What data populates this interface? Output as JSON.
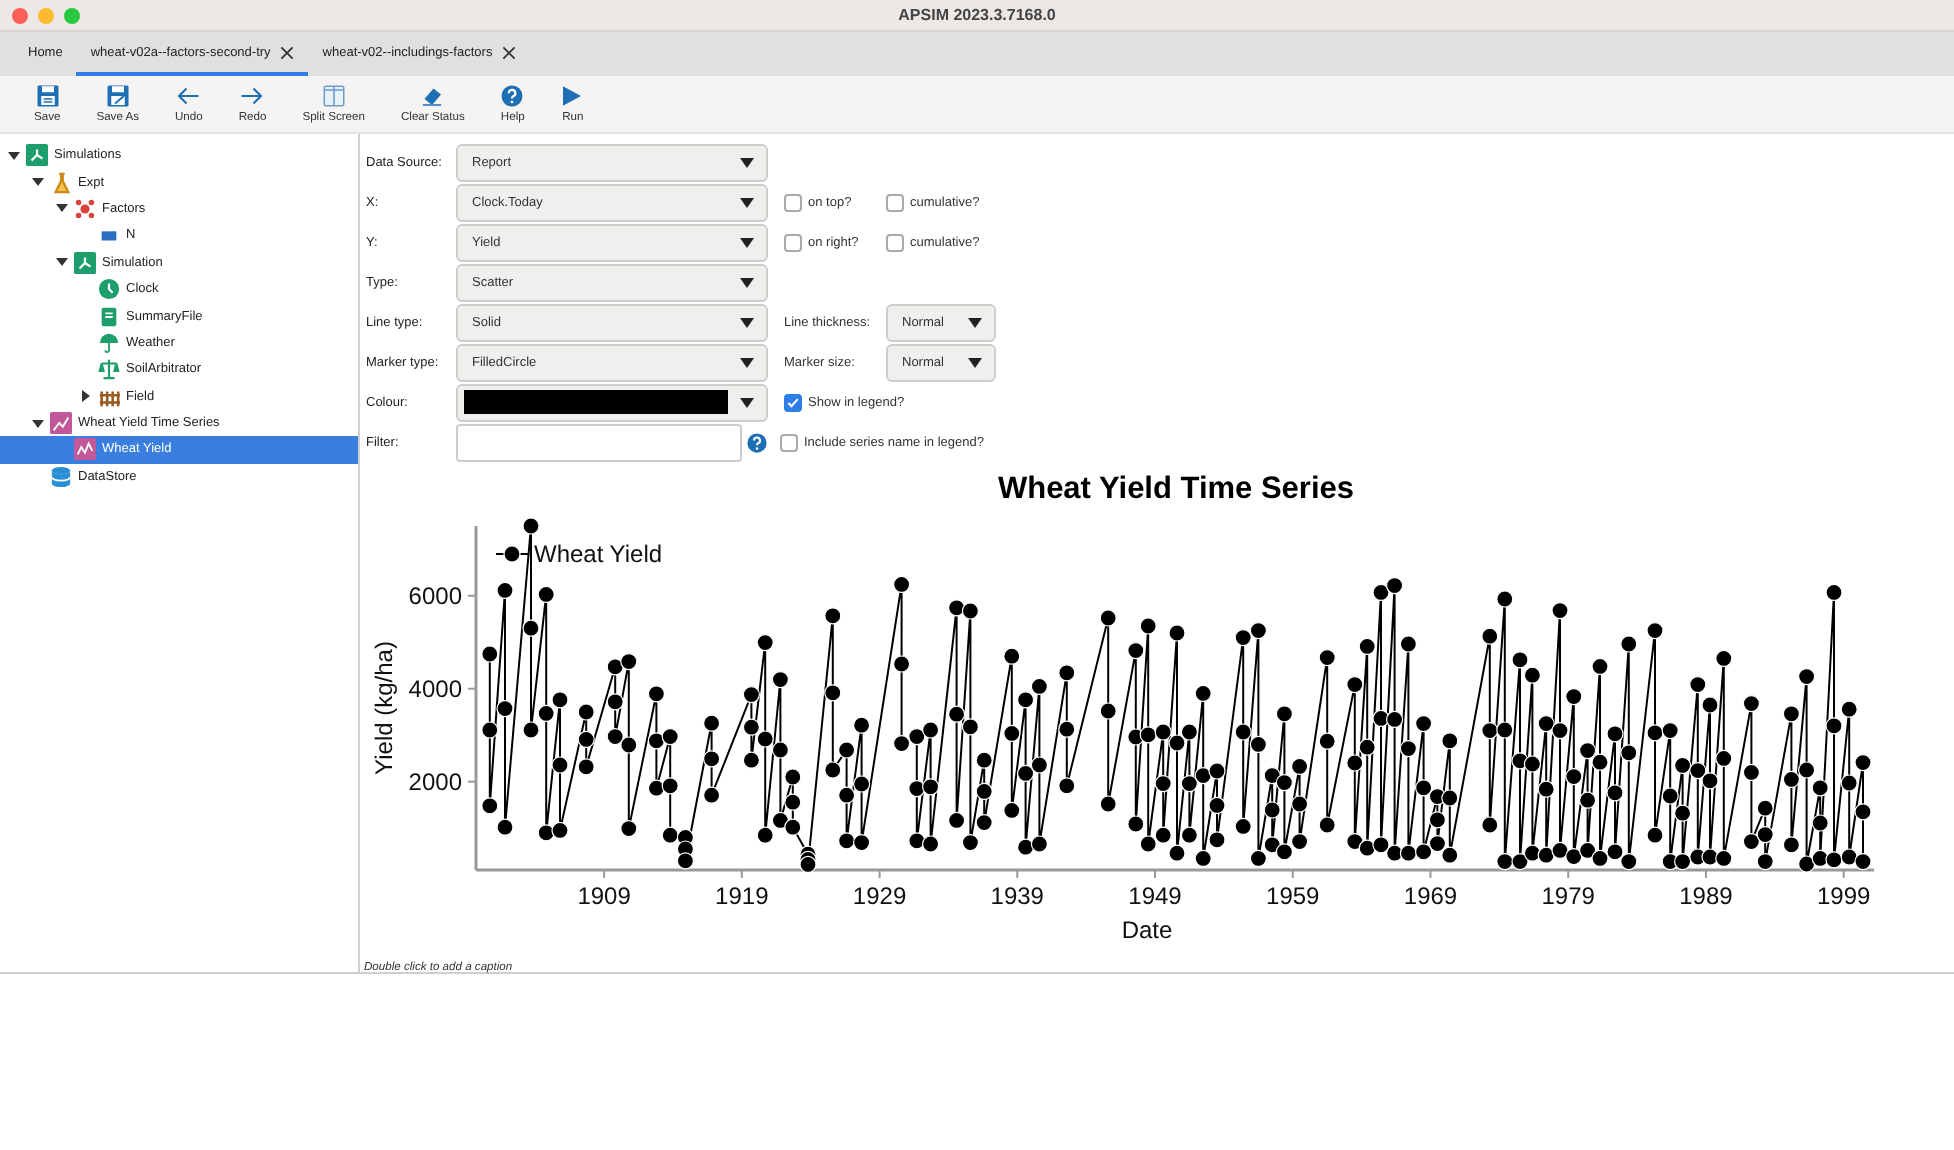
{
  "window": {
    "title": "APSIM 2023.3.7168.0"
  },
  "tabs": [
    {
      "label": "Home",
      "selected": false,
      "closable": false
    },
    {
      "label": "wheat-v02a--factors-second-try",
      "selected": true,
      "closable": true
    },
    {
      "label": "wheat-v02--includings-factors",
      "selected": false,
      "closable": true
    }
  ],
  "toolbar": [
    {
      "kind": "save",
      "label": "Save"
    },
    {
      "kind": "saveas",
      "label": "Save As"
    },
    {
      "kind": "undo",
      "label": "Undo"
    },
    {
      "kind": "redo",
      "label": "Redo"
    },
    {
      "kind": "split",
      "label": "Split Screen"
    },
    {
      "kind": "clear",
      "label": "Clear Status"
    },
    {
      "kind": "help",
      "label": "Help"
    },
    {
      "kind": "run",
      "label": "Run"
    }
  ],
  "tree": [
    {
      "kind": "simulations",
      "label": "Simulations",
      "selected": false,
      "expanded": true,
      "children": [
        {
          "kind": "experiment",
          "label": "Expt",
          "selected": false,
          "expanded": true,
          "children": [
            {
              "kind": "factors",
              "label": "Factors",
              "selected": false,
              "expanded": true,
              "children": [
                {
                  "kind": "factor",
                  "label": "N",
                  "selected": false
                }
              ]
            },
            {
              "kind": "simulation",
              "label": "Simulation",
              "selected": false,
              "expanded": true,
              "children": [
                {
                  "kind": "clock",
                  "label": "Clock",
                  "selected": false
                },
                {
                  "kind": "summary",
                  "label": "SummaryFile",
                  "selected": false
                },
                {
                  "kind": "weather",
                  "label": "Weather",
                  "selected": false
                },
                {
                  "kind": "soil",
                  "label": "SoilArbitrator",
                  "selected": false
                },
                {
                  "kind": "field",
                  "label": "Field",
                  "selected": false,
                  "expanded": false
                }
              ]
            }
          ]
        },
        {
          "kind": "graph",
          "label": "Wheat Yield Time Series",
          "selected": false,
          "expanded": true,
          "children": [
            {
              "kind": "series",
              "label": "Wheat Yield",
              "selected": true
            }
          ]
        },
        {
          "kind": "datastore",
          "label": "DataStore",
          "selected": false
        }
      ]
    }
  ],
  "series_form": [
    {
      "label": "Data Source:",
      "kind": "dropdown",
      "value": "Report"
    },
    {
      "label": "X:",
      "kind": "dropdown",
      "value": "Clock.Today",
      "extras": [
        {
          "kind": "checkbox",
          "label": "on top?",
          "checked": false
        },
        {
          "kind": "checkbox",
          "label": "cumulative?",
          "checked": false
        }
      ]
    },
    {
      "label": "Y:",
      "kind": "dropdown",
      "value": "Yield",
      "extras": [
        {
          "kind": "checkbox",
          "label": "on right?",
          "checked": false
        },
        {
          "kind": "checkbox",
          "label": "cumulative?",
          "checked": false
        }
      ]
    },
    {
      "label": "Type:",
      "kind": "dropdown",
      "value": "Scatter"
    },
    {
      "label": "Line type:",
      "kind": "dropdown",
      "value": "Solid",
      "extras": [
        {
          "kind": "select",
          "label": "Line thickness:",
          "value": "Normal"
        }
      ]
    },
    {
      "label": "Marker type:",
      "kind": "dropdown",
      "value": "FilledCircle",
      "extras": [
        {
          "kind": "select",
          "label": "Marker size:",
          "value": "Normal"
        }
      ]
    },
    {
      "label": "Colour:",
      "kind": "colour",
      "color": "#000000",
      "extras": [
        {
          "kind": "checkbox",
          "label": "Show in legend?",
          "checked": true
        }
      ]
    },
    {
      "label": "Filter:",
      "kind": "text",
      "extras": [
        {
          "kind": "checkbox",
          "label": "Include series name in legend?",
          "checked": false
        }
      ]
    }
  ],
  "graph": {
    "caption": "Double click to add a caption",
    "chart_data": {
      "type": "line",
      "title": "Wheat Yield Time Series",
      "xlabel": "Date",
      "ylabel": "Yield (kg/ha)",
      "xlim": [
        1899.7,
        2001.2
      ],
      "ylim": [
        100,
        7500
      ],
      "xticks": [
        1909,
        1919,
        1929,
        1939,
        1949,
        1959,
        1969,
        1979,
        1989,
        1999
      ],
      "yticks": [
        2000,
        4000,
        6000
      ],
      "x": [
        1900.7,
        1900.7,
        1900.7,
        1901.8,
        1901.8,
        1901.8,
        1903.7,
        1903.7,
        1903.7,
        1904.8,
        1904.8,
        1904.8,
        1905.8,
        1905.8,
        1905.8,
        1907.7,
        1907.7,
        1907.7,
        1909.8,
        1909.8,
        1909.8,
        1910.8,
        1910.8,
        1910.8,
        1912.8,
        1912.8,
        1912.8,
        1913.8,
        1913.8,
        1913.8,
        1914.9,
        1914.9,
        1914.9,
        1916.8,
        1916.8,
        1916.8,
        1919.7,
        1919.7,
        1919.7,
        1920.7,
        1920.7,
        1920.7,
        1921.8,
        1921.8,
        1921.8,
        1922.7,
        1922.7,
        1922.7,
        1923.8,
        1923.8,
        1923.8,
        1925.6,
        1925.6,
        1925.6,
        1926.6,
        1926.6,
        1926.6,
        1927.7,
        1927.7,
        1927.7,
        1930.6,
        1930.6,
        1930.6,
        1931.7,
        1931.7,
        1931.7,
        1932.7,
        1932.7,
        1932.7,
        1934.6,
        1934.6,
        1934.6,
        1935.6,
        1935.6,
        1935.6,
        1936.6,
        1936.6,
        1936.6,
        1938.6,
        1938.6,
        1938.6,
        1939.6,
        1939.6,
        1939.6,
        1940.6,
        1940.6,
        1940.6,
        1942.6,
        1942.6,
        1942.6,
        1945.6,
        1945.6,
        1945.6,
        1947.6,
        1947.6,
        1947.6,
        1948.5,
        1948.5,
        1948.5,
        1949.6,
        1949.6,
        1949.6,
        1950.6,
        1950.6,
        1950.6,
        1951.5,
        1951.5,
        1951.5,
        1952.5,
        1952.5,
        1952.5,
        1953.5,
        1953.5,
        1953.5,
        1955.4,
        1955.4,
        1955.4,
        1956.5,
        1956.5,
        1956.5,
        1957.5,
        1957.5,
        1957.5,
        1958.4,
        1958.4,
        1958.4,
        1959.5,
        1959.5,
        1959.5,
        1961.5,
        1961.5,
        1961.5,
        1963.5,
        1963.5,
        1963.5,
        1964.4,
        1964.4,
        1964.4,
        1965.4,
        1965.4,
        1965.4,
        1966.4,
        1966.4,
        1966.4,
        1967.4,
        1967.4,
        1967.4,
        1968.5,
        1968.5,
        1968.5,
        1969.5,
        1969.5,
        1969.5,
        1970.4,
        1970.4,
        1970.4,
        1973.3,
        1973.3,
        1973.3,
        1974.4,
        1974.4,
        1974.4,
        1975.5,
        1975.5,
        1975.5,
        1976.4,
        1976.4,
        1976.4,
        1977.4,
        1977.4,
        1977.4,
        1978.4,
        1978.4,
        1978.4,
        1979.4,
        1979.4,
        1979.4,
        1980.4,
        1980.4,
        1980.4,
        1981.3,
        1981.3,
        1981.3,
        1982.4,
        1982.4,
        1982.4,
        1983.4,
        1983.4,
        1983.4,
        1985.3,
        1985.3,
        1985.3,
        1986.4,
        1986.4,
        1986.4,
        1987.3,
        1987.3,
        1987.3,
        1988.4,
        1988.4,
        1988.4,
        1989.3,
        1989.3,
        1989.3,
        1990.3,
        1990.3,
        1990.3,
        1992.3,
        1992.3,
        1992.3,
        1993.3,
        1993.3,
        1993.3,
        1995.2,
        1995.2,
        1995.2,
        1996.3,
        1996.3,
        1996.3,
        1997.3,
        1997.3,
        1997.3,
        1998.3,
        1998.3,
        1998.3,
        1999.4,
        1999.4,
        1999.4,
        2000.4,
        2000.4,
        2000.4
      ],
      "series": [
        {
          "name": "Wheat Yield",
          "color": "#000000",
          "marker": "circle",
          "values": [
            4745,
            3110,
            1480,
            6115,
            3570,
            1020,
            7500,
            5300,
            3110,
            6030,
            3470,
            900,
            3760,
            2360,
            950,
            3500,
            2910,
            2320,
            4470,
            3720,
            2970,
            4585,
            2790,
            990,
            3890,
            2880,
            1860,
            2970,
            1910,
            850,
            800,
            550,
            300,
            3260,
            2490,
            1710,
            3875,
            3170,
            2460,
            4990,
            2920,
            850,
            4195,
            2680,
            1165,
            2100,
            1560,
            1020,
            440,
            330,
            220,
            5570,
            3910,
            2250,
            2680,
            1710,
            730,
            3215,
            1950,
            690,
            6245,
            4530,
            2820,
            2970,
            1850,
            730,
            3110,
            1890,
            660,
            5740,
            3450,
            1165,
            5670,
            3180,
            690,
            2460,
            1790,
            1120,
            4700,
            3040,
            1380,
            3760,
            2180,
            590,
            4050,
            2360,
            660,
            4340,
            3130,
            1910,
            5520,
            3520,
            1520,
            4820,
            2960,
            1090,
            5350,
            3010,
            660,
            3070,
            1960,
            850,
            5200,
            2830,
            460,
            3070,
            1960,
            850,
            3900,
            2130,
            350,
            2230,
            1490,
            750,
            5100,
            3070,
            1040,
            5250,
            2800,
            350,
            2130,
            1390,
            640,
            3460,
            1980,
            490,
            2330,
            1520,
            710,
            4670,
            2870,
            1070,
            4090,
            2400,
            710,
            4910,
            2740,
            570,
            6070,
            3360,
            640,
            6220,
            3340,
            460,
            4960,
            2710,
            460,
            3250,
            1870,
            490,
            1680,
            1180,
            670,
            2880,
            1650,
            420,
            5130,
            3100,
            1070,
            5930,
            3110,
            280,
            4620,
            2450,
            280,
            4290,
            2380,
            460,
            3250,
            1840,
            420,
            5680,
            3100,
            520,
            3830,
            2110,
            390,
            2670,
            1600,
            520,
            4480,
            2420,
            350,
            3030,
            1760,
            490,
            4960,
            2620,
            280,
            5250,
            3050,
            850,
            3100,
            1690,
            280,
            2350,
            1320,
            280,
            4090,
            2240,
            380,
            3650,
            2020,
            380,
            4650,
            2500,
            350,
            3680,
            2200,
            710,
            1430,
            860,
            280,
            3460,
            2050,
            640,
            4260,
            2250,
            230,
            1870,
            1110,
            350,
            6070,
            3200,
            320,
            3560,
            1970,
            380,
            2410,
            1350,
            280
          ]
        }
      ]
    }
  }
}
